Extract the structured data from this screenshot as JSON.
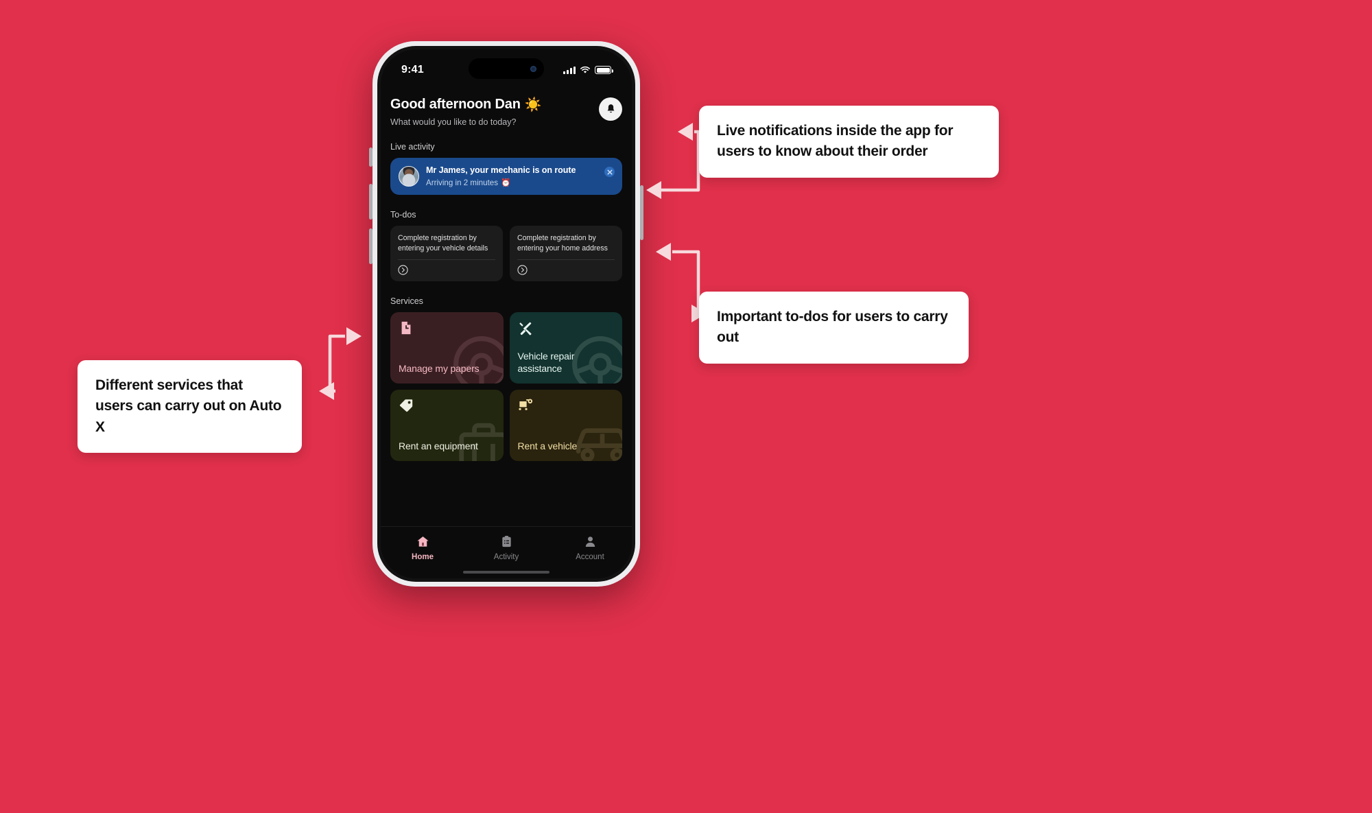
{
  "background_color": "#e0304b",
  "phone": {
    "status_bar": {
      "time": "9:41",
      "signal_icon": "cellular-signal-icon",
      "wifi_icon": "wifi-icon",
      "battery_icon": "battery-icon"
    },
    "header": {
      "greeting": "Good afternoon Dan",
      "greeting_emoji": "☀️",
      "subtitle": "What would you like to do today?",
      "bell_icon": "bell-icon"
    },
    "live_activity": {
      "label": "Live activity",
      "title": "Mr James, your mechanic is on route",
      "subtitle": "Arriving in 2 minutes",
      "subtitle_emoji": "⏰",
      "close_icon": "close-icon",
      "card_color": "#1b4a8c"
    },
    "todos": {
      "label": "To-dos",
      "items": [
        {
          "text": "Complete registration by entering your vehicle details",
          "arrow_icon": "chevron-right-circle-icon"
        },
        {
          "text": "Complete registration by entering your home address",
          "arrow_icon": "chevron-right-circle-icon"
        }
      ]
    },
    "services": {
      "label": "Services",
      "items": [
        {
          "title": "Manage my papers",
          "icon": "document-clock-icon",
          "watermark_icon": "steering-wheel-icon",
          "bg_color": "#3a1f22",
          "text_color": "#f6b9c3",
          "icon_color": "#f3b8c4"
        },
        {
          "title": "Vehicle repair assistance",
          "icon": "tools-icon",
          "watermark_icon": "steering-wheel-icon",
          "bg_color": "#12332f",
          "text_color": "#e7f5f1",
          "icon_color": "#eaf6f2"
        },
        {
          "title": "Rent an equipment",
          "icon": "tag-icon",
          "watermark_icon": "toolbox-icon",
          "bg_color": "#22270f",
          "text_color": "#eef0e3",
          "icon_color": "#eef0e3"
        },
        {
          "title": "Rent a vehicle",
          "icon": "bus-icon",
          "watermark_icon": "car-icon",
          "bg_color": "#2a230e",
          "text_color": "#f2dfa5",
          "icon_color": "#f2dfa5"
        }
      ]
    },
    "tab_bar": {
      "items": [
        {
          "label": "Home",
          "icon": "home-icon",
          "active": true
        },
        {
          "label": "Activity",
          "icon": "clipboard-icon",
          "active": false
        },
        {
          "label": "Account",
          "icon": "person-icon",
          "active": false
        }
      ]
    }
  },
  "annotations": [
    {
      "id": "notifications",
      "text": "Live notifications inside the app for users to know about their order"
    },
    {
      "id": "todos",
      "text": "Important to-dos for users to carry out"
    },
    {
      "id": "services",
      "text": "Different services that users can carry out on Auto X"
    }
  ]
}
